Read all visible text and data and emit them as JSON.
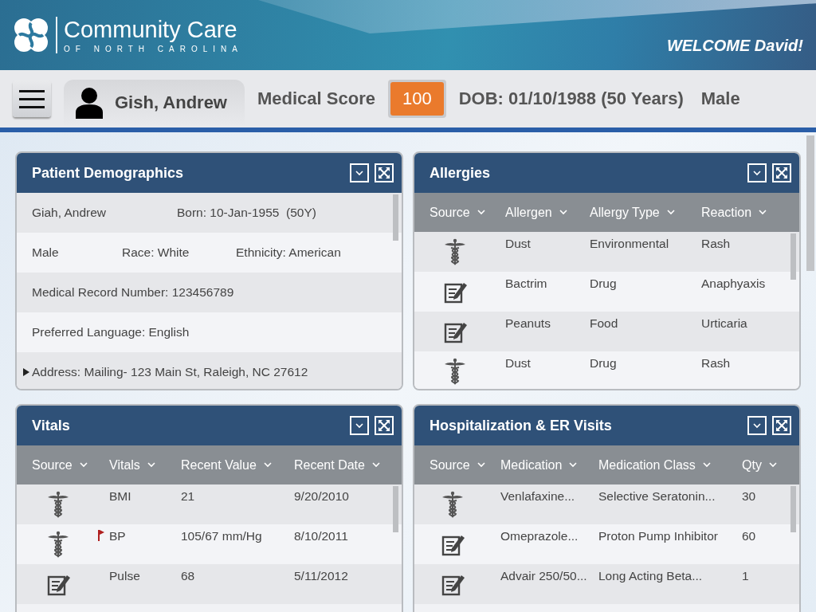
{
  "header": {
    "logo_title": "Community Care",
    "logo_subtitle": "OF NORTH CAROLINA",
    "welcome": "WELCOME David!"
  },
  "patient_bar": {
    "name": "Gish, Andrew",
    "score_label": "Medical Score",
    "score": "100",
    "dob": "DOB: 01/10/1988 (50 Years)",
    "gender": "Male"
  },
  "panels": [
    {
      "kind": "fields",
      "title": "Patient Demographics",
      "rows": [
        {
          "kind": "text",
          "fields": [
            "Giah, Andrew",
            "Born: 10-Jan-1955  (50Y)"
          ]
        },
        {
          "kind": "text",
          "fields": [
            "Male",
            "Race: White",
            "Ethnicity: American"
          ]
        },
        {
          "kind": "text",
          "fields": [
            "Medical Record Number: 123456789"
          ]
        },
        {
          "kind": "text",
          "fields": [
            "Preferred Language: English"
          ]
        },
        {
          "kind": "expander",
          "expanded": false,
          "fields": [
            "Address: Mailing- 123 Main St, Raleigh, NC 27612"
          ]
        }
      ]
    },
    {
      "kind": "table",
      "title": "Allergies",
      "source_column": "Source",
      "columns": [
        "Allergen",
        "Allergy Type",
        "Reaction"
      ],
      "rows": [
        {
          "kind": "caduceus",
          "cells": [
            "Dust",
            "Environmental",
            "Rash"
          ]
        },
        {
          "kind": "note",
          "cells": [
            "Bactrim",
            "Drug",
            "Anaphyaxis"
          ]
        },
        {
          "kind": "note",
          "cells": [
            "Peanuts",
            "Food",
            "Urticaria"
          ]
        },
        {
          "kind": "caduceus",
          "cells": [
            "Dust",
            "Drug",
            "Rash"
          ]
        }
      ]
    },
    {
      "kind": "table",
      "title": "Vitals",
      "source_column": "Source",
      "columns": [
        "Vitals",
        "Recent Value",
        "Recent Date"
      ],
      "rows": [
        {
          "kind": "caduceus",
          "flagged": false,
          "cells": [
            "BMI",
            "21",
            "9/20/2010"
          ]
        },
        {
          "kind": "caduceus",
          "flagged": true,
          "cells": [
            "BP",
            "105/67 mm/Hg",
            "8/10/2011"
          ]
        },
        {
          "kind": "note",
          "flagged": false,
          "cells": [
            "Pulse",
            "68",
            "5/11/2012"
          ]
        }
      ]
    },
    {
      "kind": "table",
      "title": "Hospitalization & ER Visits",
      "source_column": "Source",
      "columns": [
        "Medication",
        "Medication Class",
        "Qty"
      ],
      "rows": [
        {
          "kind": "caduceus",
          "cells": [
            "Venlafaxine...",
            "Selective Seratonin...",
            "30"
          ]
        },
        {
          "kind": "note",
          "cells": [
            "Omeprazole...",
            "Proton Pump Inhibitor",
            "60"
          ]
        },
        {
          "kind": "note",
          "cells": [
            "Advair 250/50...",
            "Long Acting Beta...",
            "1"
          ]
        }
      ]
    }
  ]
}
